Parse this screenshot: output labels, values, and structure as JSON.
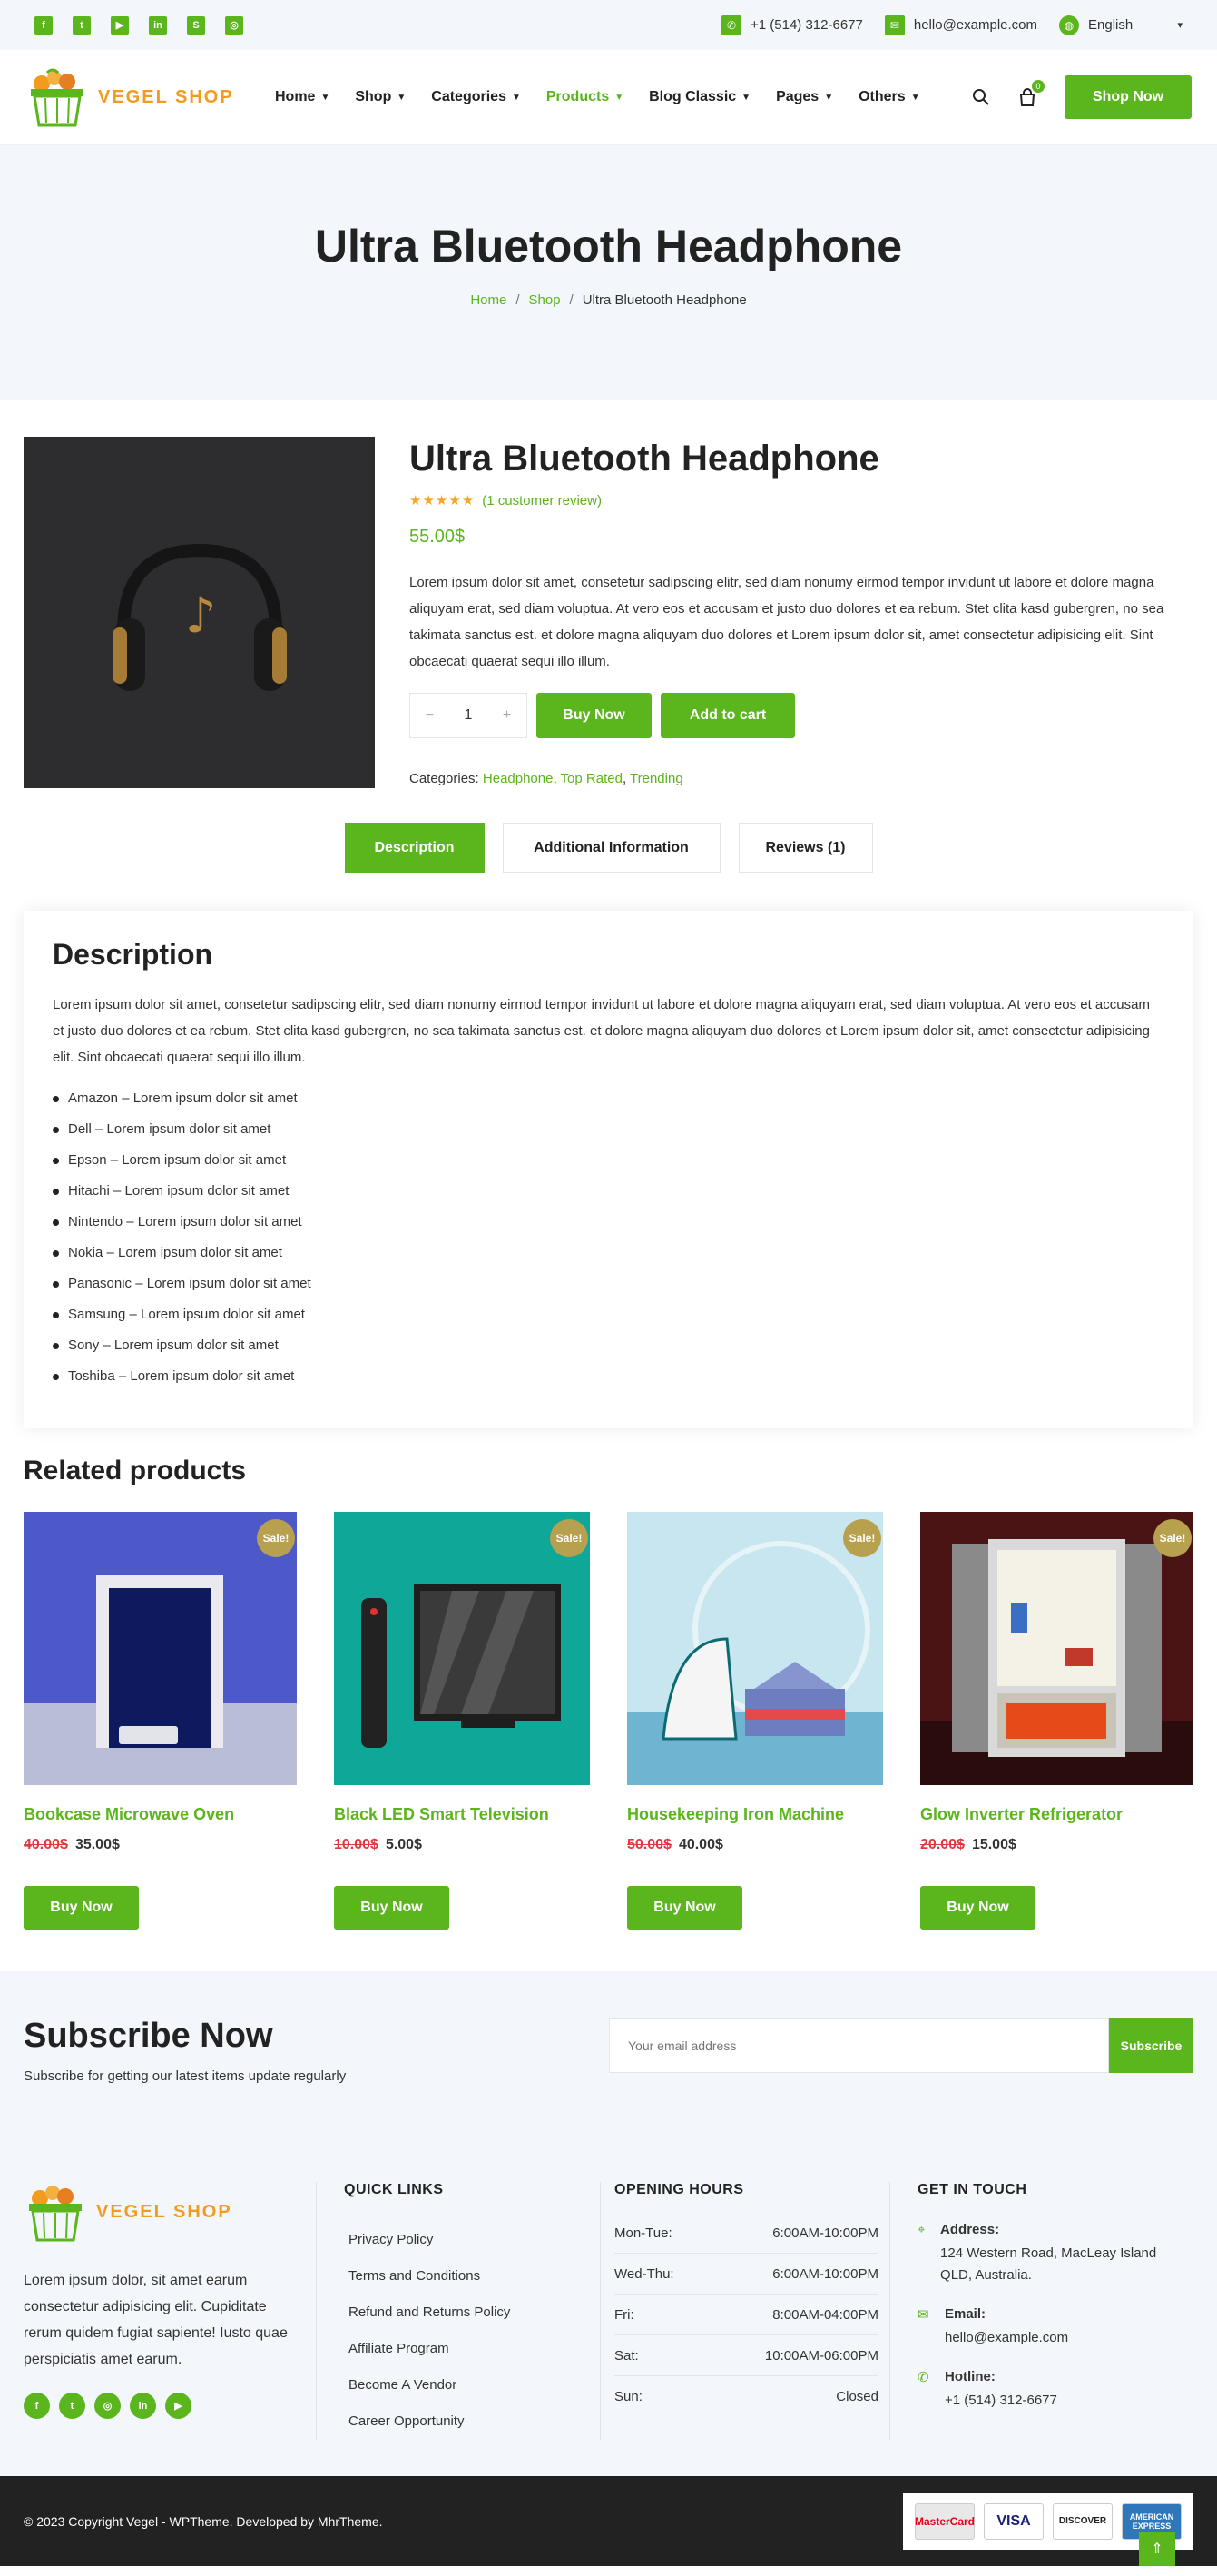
{
  "topbar": {
    "socials": [
      "facebook",
      "twitter",
      "youtube",
      "linkedin",
      "skype",
      "instagram"
    ],
    "phone": "+1 (514) 312-6677",
    "email": "hello@example.com",
    "language": "English"
  },
  "header": {
    "logo_text": "VEGEL SHOP",
    "nav": [
      "Home",
      "Shop",
      "Categories",
      "Products",
      "Blog Classic",
      "Pages",
      "Others"
    ],
    "cart_count": "0",
    "cta": "Shop Now"
  },
  "hero": {
    "title": "Ultra Bluetooth Headphone",
    "breadcrumb": [
      "Home",
      "Shop",
      "Ultra Bluetooth Headphone"
    ]
  },
  "product": {
    "title": "Ultra Bluetooth Headphone",
    "stars": "★★★★★",
    "review_link": "(1 customer review)",
    "price": "55.00$",
    "description": "Lorem ipsum dolor sit amet, consetetur sadipscing elitr, sed diam nonumy eirmod tempor invidunt ut labore et dolore magna aliquyam erat, sed diam voluptua. At vero eos et accusam et justo duo dolores et ea rebum. Stet clita kasd gubergren, no sea takimata sanctus est. et dolore magna aliquyam duo dolores et Lorem ipsum dolor sit, amet consectetur adipisicing elit. Sint obcaecati quaerat sequi illo illum.",
    "qty_minus": "−",
    "quantity": "1",
    "qty_plus": "+",
    "buy_label": "Buy Now",
    "cart_label": "Add to cart",
    "categories_label": "Categories:",
    "categories": [
      "Headphone",
      "Top Rated",
      "Trending"
    ]
  },
  "tabs": [
    "Description",
    "Additional Information",
    "Reviews (1)"
  ],
  "description": {
    "heading": "Description",
    "text": "Lorem ipsum dolor sit amet, consetetur sadipscing elitr, sed diam nonumy eirmod tempor invidunt ut labore et dolore magna aliquyam erat, sed diam voluptua. At vero eos et accusam et justo duo dolores et ea rebum. Stet clita kasd gubergren, no sea takimata sanctus est. et dolore magna aliquyam duo dolores et Lorem ipsum dolor sit, amet consectetur adipisicing elit. Sint obcaecati quaerat sequi illo illum.",
    "items": [
      "Amazon – Lorem ipsum dolor sit amet",
      "Dell – Lorem ipsum dolor sit amet",
      "Epson – Lorem ipsum dolor sit amet",
      "Hitachi – Lorem ipsum dolor sit amet",
      "Nintendo – Lorem ipsum dolor sit amet",
      "Nokia – Lorem ipsum dolor sit amet",
      "Panasonic – Lorem ipsum dolor sit amet",
      "Samsung – Lorem ipsum dolor sit amet",
      "Sony – Lorem ipsum dolor sit amet",
      "Toshiba – Lorem ipsum dolor sit amet"
    ]
  },
  "related": {
    "heading": "Related products",
    "sale_badge": "Sale!",
    "button": "Buy Now",
    "items": [
      {
        "title": "Bookcase Microwave Oven",
        "old_price": "40.00$",
        "price": "35.00$"
      },
      {
        "title": "Black LED Smart Television",
        "old_price": "10.00$",
        "price": "5.00$"
      },
      {
        "title": "Housekeeping Iron Machine",
        "old_price": "50.00$",
        "price": "40.00$"
      },
      {
        "title": "Glow Inverter Refrigerator",
        "old_price": "20.00$",
        "price": "15.00$"
      }
    ]
  },
  "subscribe": {
    "heading": "Subscribe Now",
    "subtext": "Subscribe for getting our latest items update regularly",
    "placeholder": "Your email address",
    "button": "Subscribe"
  },
  "footer": {
    "logo_text": "VEGEL SHOP",
    "about": "Lorem ipsum dolor, sit amet earum consectetur adipisicing elit. Cupiditate rerum quidem fugiat sapiente! Iusto quae perspiciatis amet earum.",
    "quick_links_heading": "QUICK LINKS",
    "quick_links": [
      "Privacy Policy",
      "Terms and Conditions",
      "Refund and Returns Policy",
      "Affiliate Program",
      "Become A Vendor",
      "Career Opportunity"
    ],
    "hours_heading": "OPENING HOURS",
    "hours": [
      {
        "day": "Mon-Tue:",
        "time": "6:00AM-10:00PM"
      },
      {
        "day": "Wed-Thu:",
        "time": "6:00AM-10:00PM"
      },
      {
        "day": "Fri:",
        "time": "8:00AM-04:00PM"
      },
      {
        "day": "Sat:",
        "time": "10:00AM-06:00PM"
      },
      {
        "day": "Sun:",
        "time": "Closed"
      }
    ],
    "contact_heading": "GET IN TOUCH",
    "address_label": "Address:",
    "address": "124 Western Road, MacLeay Island QLD, Australia.",
    "email_label": "Email:",
    "email": "hello@example.com",
    "hotline_label": "Hotline:",
    "hotline": "+1 (514) 312-6677",
    "copyright": "© 2023 Copyright Vegel - WPTheme. Developed by MhrTheme.",
    "payment_cards": [
      "MasterCard",
      "VISA",
      "DISCOVER",
      "AMERICAN EXPRESS"
    ]
  },
  "colors": {
    "accent": "#5bb51d",
    "logo": "#f29b1e",
    "sale": "#b8a14e",
    "old_price": "#e0383e"
  }
}
